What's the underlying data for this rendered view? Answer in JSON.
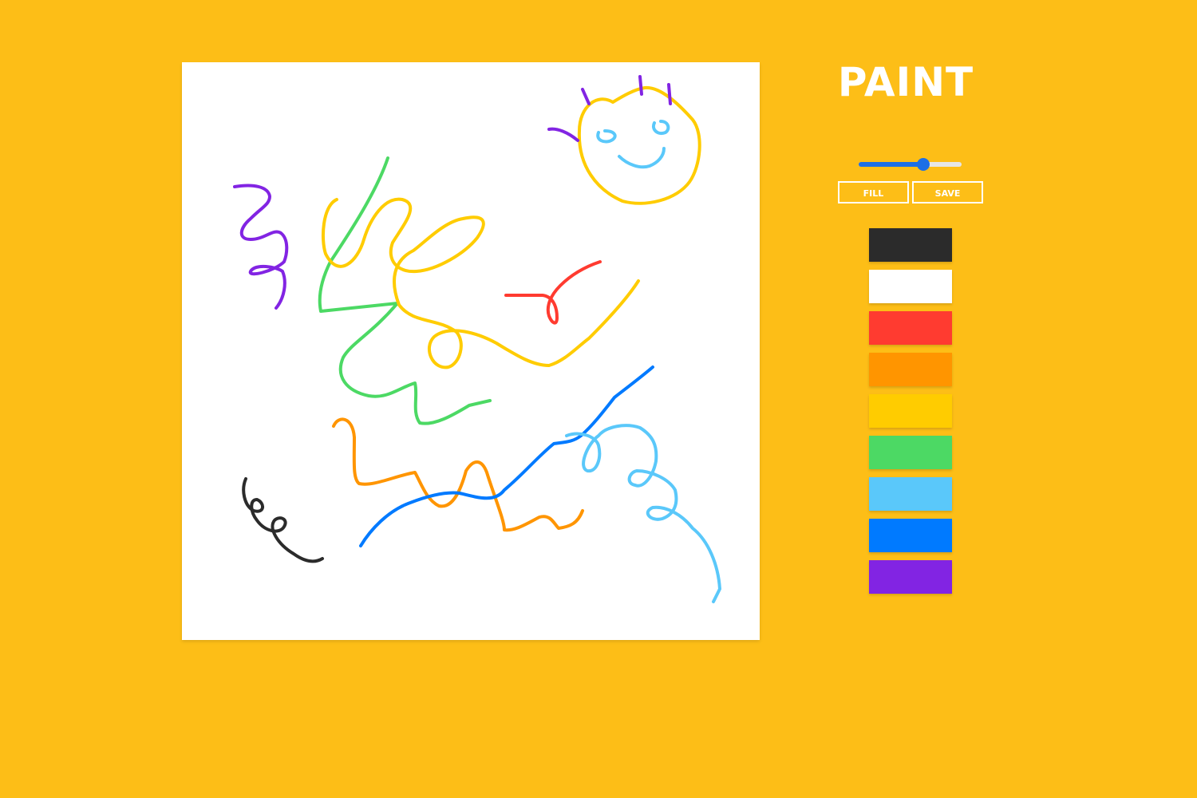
{
  "app": {
    "title": "PAINT",
    "background_color": "#FDBE17"
  },
  "brush_slider": {
    "value_percent": 63,
    "accent_color": "#1C6FE6"
  },
  "buttons": {
    "fill_label": "FILL",
    "save_label": "SAVE"
  },
  "palette": [
    {
      "name": "black",
      "color": "#2B2B2B"
    },
    {
      "name": "white",
      "color": "#FFFFFF"
    },
    {
      "name": "red",
      "color": "#FF3B30"
    },
    {
      "name": "orange",
      "color": "#FF9500"
    },
    {
      "name": "yellow",
      "color": "#FFCC00"
    },
    {
      "name": "green",
      "color": "#4CD964"
    },
    {
      "name": "light-blue",
      "color": "#5AC8FA"
    },
    {
      "name": "blue",
      "color": "#007AFF"
    },
    {
      "name": "purple",
      "color": "#8224E3"
    }
  ],
  "canvas": {
    "background_color": "#FFFFFF",
    "strokes": [
      {
        "name": "purple-squiggle",
        "color": "purple"
      },
      {
        "name": "green-zigzag",
        "color": "green"
      },
      {
        "name": "yellow-loops",
        "color": "yellow"
      },
      {
        "name": "red-loop",
        "color": "red"
      },
      {
        "name": "sun-face",
        "color": "yellow"
      },
      {
        "name": "sun-eyes-smile",
        "color": "light-blue"
      },
      {
        "name": "sun-rays",
        "color": "purple"
      },
      {
        "name": "orange-zigzag",
        "color": "orange"
      },
      {
        "name": "blue-wave",
        "color": "blue"
      },
      {
        "name": "light-blue-loops",
        "color": "light-blue"
      },
      {
        "name": "black-loops",
        "color": "black"
      }
    ]
  }
}
